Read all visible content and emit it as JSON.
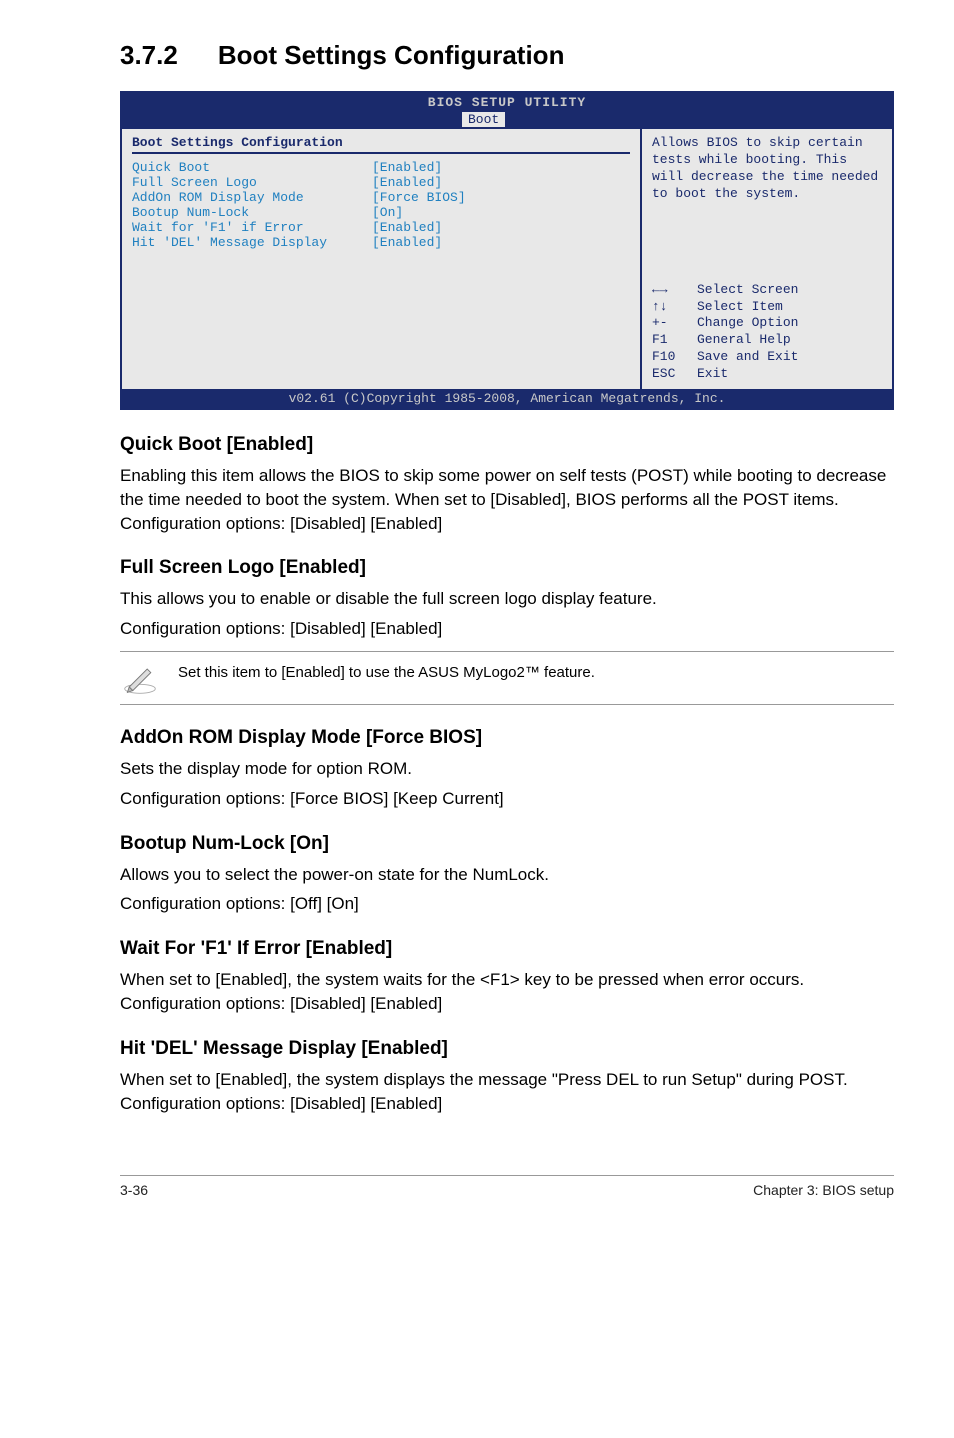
{
  "section": {
    "number": "3.7.2",
    "title": "Boot Settings Configuration"
  },
  "bios": {
    "title": "BIOS SETUP UTILITY",
    "tab": "Boot",
    "heading": "Boot Settings Configuration",
    "items": [
      {
        "label": "Quick Boot",
        "value": "[Enabled]"
      },
      {
        "label": "Full Screen Logo",
        "value": "[Enabled]"
      },
      {
        "label": "AddOn ROM Display Mode",
        "value": "[Force BIOS]"
      },
      {
        "label": "Bootup Num-Lock",
        "value": "[On]"
      },
      {
        "label": "Wait for 'F1' if Error",
        "value": "[Enabled]"
      },
      {
        "label": "Hit 'DEL' Message Display",
        "value": "[Enabled]"
      }
    ],
    "help": "Allows BIOS to skip certain tests while booting. This will decrease the time needed to boot the system.",
    "nav": [
      {
        "key": "←→",
        "desc": "Select Screen"
      },
      {
        "key": "↑↓",
        "desc": "Select Item"
      },
      {
        "key": "+-",
        "desc": "Change Option"
      },
      {
        "key": "F1",
        "desc": "General Help"
      },
      {
        "key": "F10",
        "desc": "Save and Exit"
      },
      {
        "key": "ESC",
        "desc": "Exit"
      }
    ],
    "footer": "v02.61 (C)Copyright 1985-2008, American Megatrends, Inc."
  },
  "content": {
    "quick_boot": {
      "heading": "Quick Boot [Enabled]",
      "body": "Enabling this item allows the BIOS to skip some power on self tests (POST) while booting to decrease the time needed to boot the system. When set to [Disabled], BIOS performs all the POST items. Configuration options: [Disabled] [Enabled]"
    },
    "full_screen": {
      "heading": "Full Screen Logo [Enabled]",
      "body1": "This allows you to enable or disable the full screen logo display feature.",
      "body2": "Configuration options: [Disabled] [Enabled]",
      "note": "Set this item to [Enabled] to use the ASUS MyLogo2™ feature."
    },
    "addon": {
      "heading": "AddOn ROM Display Mode [Force BIOS]",
      "body1": "Sets the display mode for option ROM.",
      "body2": "Configuration options: [Force BIOS] [Keep Current]"
    },
    "bootup": {
      "heading": "Bootup Num-Lock [On]",
      "body1": "Allows you to select the power-on state for the NumLock.",
      "body2": "Configuration options: [Off] [On]"
    },
    "wait_f1": {
      "heading": "Wait For 'F1' If Error [Enabled]",
      "body": "When set to [Enabled], the system waits for the <F1> key to be pressed when error occurs. Configuration options: [Disabled] [Enabled]"
    },
    "hit_del": {
      "heading": "Hit 'DEL' Message Display [Enabled]",
      "body": "When set to [Enabled], the system displays the message \"Press DEL to run Setup\" during POST. Configuration options: [Disabled] [Enabled]"
    }
  },
  "footer": {
    "left": "3-36",
    "right": "Chapter 3: BIOS setup"
  }
}
